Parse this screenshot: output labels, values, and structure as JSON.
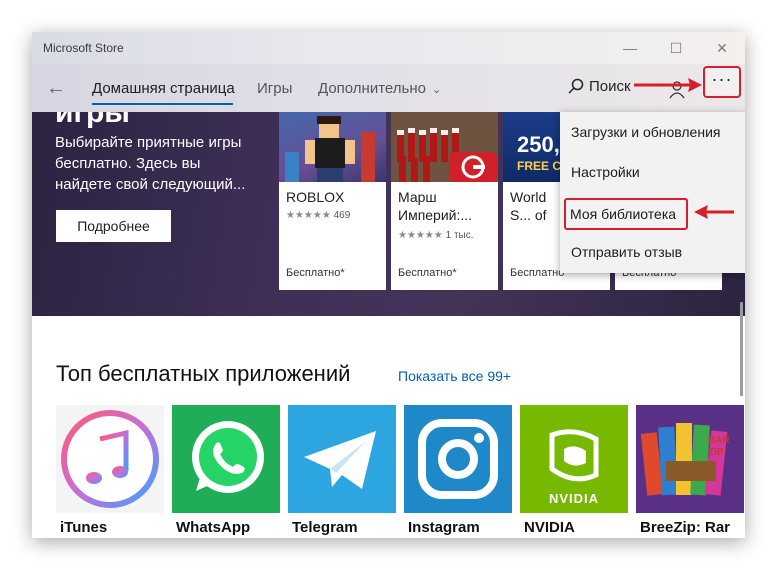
{
  "window": {
    "title": "Microsoft Store",
    "controls": {
      "minimize": "—",
      "maximize": "☐",
      "close": "✕"
    }
  },
  "nav": {
    "back": "←",
    "tabs": [
      {
        "label": "Домашняя страница",
        "active": true
      },
      {
        "label": "Игры",
        "active": false
      },
      {
        "label": "Дополнительно",
        "active": false
      }
    ],
    "more_chevron": "⌄",
    "search_label": "Поиск",
    "more_label": "···"
  },
  "hero": {
    "heading": "игры",
    "description": "Выбирайте приятные игры бесплатно. Здесь вы найдете свой следующий...",
    "button_label": "Подробнее",
    "games": [
      {
        "title": "ROBLOX",
        "stars": "★★★★★",
        "rating_count": "469",
        "price": "Бесплатно*"
      },
      {
        "title": "Марш Империй:...",
        "stars": "★★★★★",
        "rating_count": "1 тыс.",
        "price": "Бесплатно*"
      },
      {
        "title": "World S... of Poke...",
        "stars": "",
        "rating_count": "",
        "price": "Бесплатно*"
      },
      {
        "title": "",
        "stars": "",
        "rating_count": "",
        "price": "Бесплатно*"
      }
    ],
    "promo_text": "250,",
    "promo_sub": "FREE C"
  },
  "menu": {
    "items": [
      {
        "label": "Загрузки и обновления"
      },
      {
        "label": "Настройки"
      },
      {
        "label": "Моя библиотека",
        "highlighted": true
      },
      {
        "label": "Отправить отзыв"
      }
    ]
  },
  "section": {
    "title": "Топ бесплатных приложений",
    "show_all": "Показать все 99+",
    "apps": [
      {
        "name": "iTunes",
        "icon": "itunes-icon"
      },
      {
        "name": "WhatsApp",
        "icon": "whatsapp-icon"
      },
      {
        "name": "Telegram",
        "icon": "telegram-icon"
      },
      {
        "name": "Instagram",
        "icon": "instagram-icon"
      },
      {
        "name": "NVIDIA",
        "icon": "nvidia-icon"
      },
      {
        "name": "BreeZip: Rar",
        "icon": "breezip-icon"
      }
    ],
    "nvidia_logo_text": "NVIDIA",
    "breezip_box_text": "RAR ZIP"
  },
  "colors": {
    "accent": "#0063b1",
    "highlight_red": "#d61f2c",
    "whatsapp": "#25d366",
    "telegram": "#2ca5e0",
    "instagram": "#1e88c9",
    "nvidia": "#76b900"
  }
}
